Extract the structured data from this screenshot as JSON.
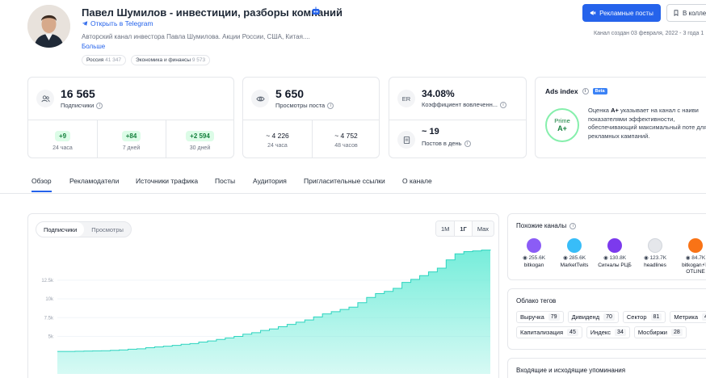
{
  "channel": {
    "title": "Павел Шумилов - инвестиции, разборы компаний",
    "open_telegram": "Открыть в Telegram",
    "description": "Авторский канал инвестора Павла Шумилова. Акции России, США, Китая....",
    "more": "Больше",
    "tags": [
      {
        "label": "Россия",
        "count": "41 347"
      },
      {
        "label": "Экономика и финансы",
        "count": "9 573"
      }
    ],
    "created": "Канал создан 03 февраля, 2022 - 3 года 1"
  },
  "buttons": {
    "ads": "Рекламные посты",
    "collection": "В колле"
  },
  "stats": {
    "subscribers": {
      "value": "16 565",
      "label": "Подписчики",
      "deltas": [
        {
          "value": "+9",
          "label": "24 часа"
        },
        {
          "value": "+84",
          "label": "7 дней"
        },
        {
          "value": "+2 594",
          "label": "30 дней"
        }
      ]
    },
    "views": {
      "value": "5 650",
      "label": "Просмотры поста",
      "subs": [
        {
          "value": "~ 4 226",
          "label": "24 часа"
        },
        {
          "value": "~ 4 752",
          "label": "48 часов"
        }
      ]
    },
    "er": {
      "icon_text": "ER",
      "value": "34.08%",
      "label": "Коэффициент вовлеченн...",
      "posts_value": "~ 19",
      "posts_label": "Постов в день"
    }
  },
  "ads_index": {
    "title": "Ads index",
    "badge": "Beta",
    "grade_top": "Prime",
    "grade": "A+",
    "text_prefix": "Оценка ",
    "text_grade": "A+",
    "text_rest": " указывает на канал с наиви показателями эффективности, обеспечивающий максимальный поте для рекламных кампаний."
  },
  "tabs": [
    "Обзор",
    "Рекламодатели",
    "Источники трафика",
    "Посты",
    "Аудитория",
    "Пригласительные ссылки",
    "О канале"
  ],
  "chart_toggle": [
    "Подписчики",
    "Просмотры"
  ],
  "chart_range": [
    "1M",
    "1Г",
    "Max"
  ],
  "chart_data": {
    "type": "area",
    "y_ticks": [
      "12.5k",
      "10k",
      "7.5k",
      "5k"
    ],
    "ylim": [
      0,
      17000
    ],
    "values": [
      3000,
      3000,
      3020,
      3050,
      3080,
      3100,
      3150,
      3200,
      3300,
      3350,
      3500,
      3600,
      3700,
      3800,
      3950,
      4050,
      4250,
      4400,
      4600,
      4800,
      5000,
      5300,
      5500,
      5800,
      6000,
      6300,
      6600,
      6900,
      7200,
      7600,
      8000,
      8300,
      8600,
      8900,
      9500,
      10200,
      10700,
      11000,
      11400,
      12200,
      12600,
      13100,
      13600,
      14100,
      15200,
      16000,
      16300,
      16400,
      16500,
      16565
    ],
    "color": "#5eead4"
  },
  "similar": {
    "title": "Похожие каналы",
    "items": [
      {
        "count": "255.6K",
        "name": "bitkogan",
        "color": "#8b5cf6"
      },
      {
        "count": "285.6K",
        "name": "MarketTwits",
        "color": "#38bdf8"
      },
      {
        "count": "130.8K",
        "name": "Сигналы РЦБ",
        "color": "#7c3aed"
      },
      {
        "count": "123.7K",
        "name": "headlines",
        "color": "#e5e7eb"
      },
      {
        "count": "84.7K",
        "name": "bitkogan⚡H OTLINE",
        "color": "#f97316"
      }
    ]
  },
  "tag_cloud": {
    "title": "Облако тегов",
    "items": [
      {
        "label": "Выручка",
        "count": "79"
      },
      {
        "label": "Дивиденд",
        "count": "70"
      },
      {
        "label": "Сектор",
        "count": "81"
      },
      {
        "label": "Метрика",
        "count": "4"
      },
      {
        "label": "Капитализация",
        "count": "45"
      },
      {
        "label": "Индекс",
        "count": "34"
      },
      {
        "label": "Мосбиржи",
        "count": "28"
      }
    ]
  },
  "mentions": {
    "title": "Входящие и исходящие упоминания"
  }
}
